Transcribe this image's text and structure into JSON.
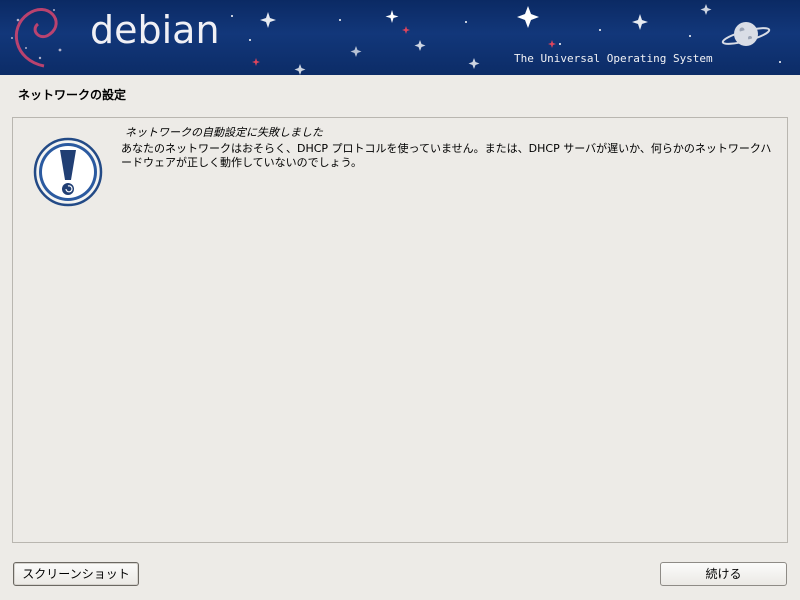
{
  "banner": {
    "brand": "debian",
    "tagline": "The Universal Operating System",
    "logo_icon": "debian-swirl-icon",
    "planet_icon": "planet-icon"
  },
  "page": {
    "title": "ネットワークの設定"
  },
  "message": {
    "icon": "warning-exclamation-icon",
    "title": "ネットワークの自動設定に失敗しました",
    "body": "あなたのネットワークはおそらく、DHCP プロトコルを使っていません。または、DHCP サーバが遅いか、何らかのネットワークハードウェアが正しく動作していないのでしょう。"
  },
  "buttons": {
    "screenshot": "スクリーンショット",
    "continue": "続ける"
  },
  "colors": {
    "banner_bg": "#12377a",
    "page_bg": "#edebe7",
    "icon_blue": "#2b5aa0"
  }
}
